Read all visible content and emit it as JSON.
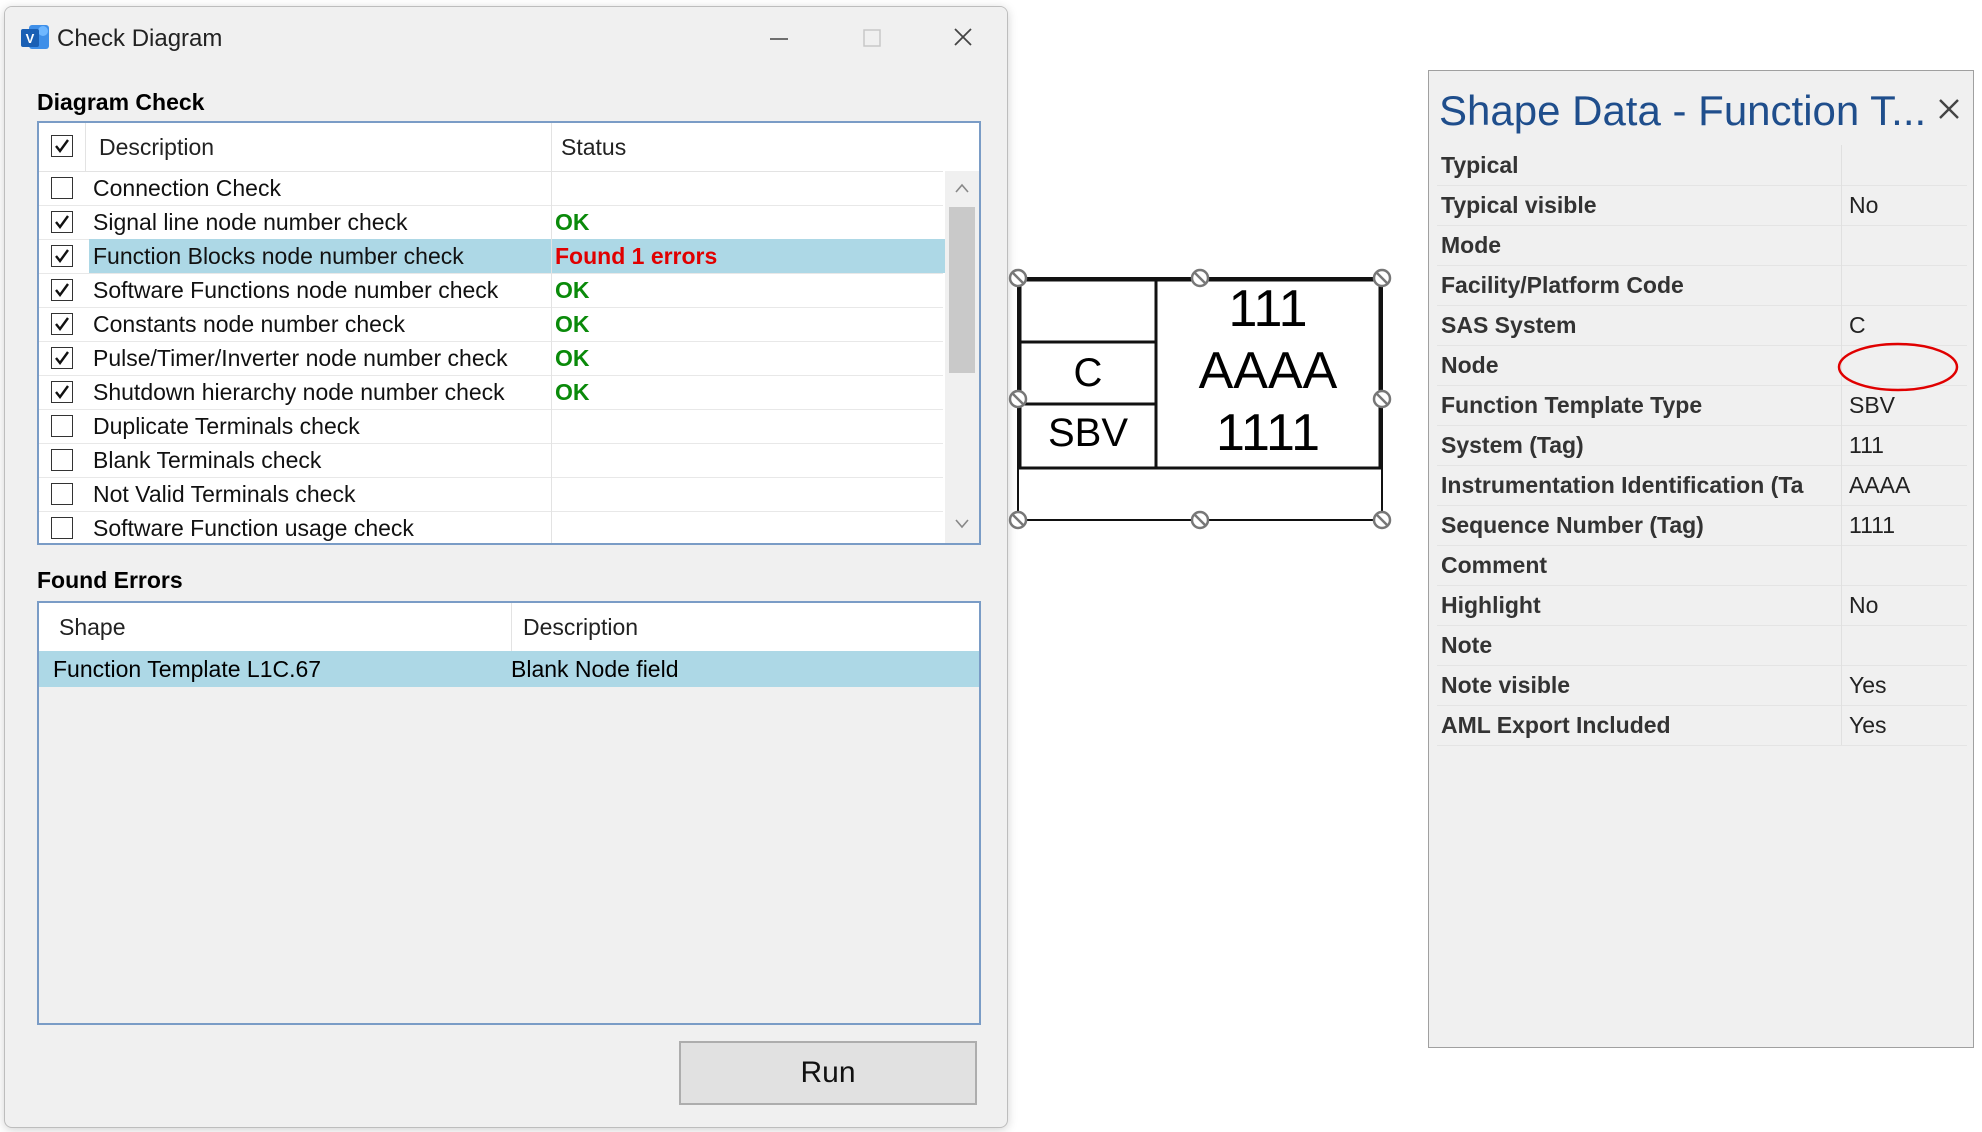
{
  "dialog": {
    "title": "Check Diagram",
    "diagram_check_label": "Diagram Check",
    "columns": {
      "description": "Description",
      "status": "Status"
    },
    "header_checked": true,
    "rows": [
      {
        "label": "Connection Check",
        "checked": false,
        "status": "",
        "status_type": ""
      },
      {
        "label": "Signal line node number check",
        "checked": true,
        "status": "OK",
        "status_type": "ok"
      },
      {
        "label": "Function Blocks node number check",
        "checked": true,
        "status": "Found 1 errors",
        "status_type": "error",
        "selected": true
      },
      {
        "label": "Software Functions node number check",
        "checked": true,
        "status": "OK",
        "status_type": "ok"
      },
      {
        "label": "Constants node number check",
        "checked": true,
        "status": "OK",
        "status_type": "ok"
      },
      {
        "label": "Pulse/Timer/Inverter node number check",
        "checked": true,
        "status": "OK",
        "status_type": "ok"
      },
      {
        "label": "Shutdown hierarchy node number check",
        "checked": true,
        "status": "OK",
        "status_type": "ok"
      },
      {
        "label": "Duplicate Terminals check",
        "checked": false,
        "status": "",
        "status_type": ""
      },
      {
        "label": "Blank Terminals check",
        "checked": false,
        "status": "",
        "status_type": ""
      },
      {
        "label": "Not Valid Terminals check",
        "checked": false,
        "status": "",
        "status_type": ""
      },
      {
        "label": "Software Function usage check",
        "checked": false,
        "status": "",
        "status_type": ""
      }
    ],
    "found_errors_label": "Found Errors",
    "errors_columns": {
      "shape": "Shape",
      "description": "Description"
    },
    "errors": [
      {
        "shape": "Function Template L1C.67",
        "description": "Blank Node field"
      }
    ],
    "run_label": "Run"
  },
  "canvas_shape": {
    "left_top": "",
    "left_mid": "C",
    "left_bottom": "SBV",
    "right_line1": "111",
    "right_line2": "AAAA",
    "right_line3": "1111"
  },
  "shape_data": {
    "title": "Shape Data - Function T...",
    "rows": [
      {
        "label": "Typical",
        "value": ""
      },
      {
        "label": "Typical visible",
        "value": "No"
      },
      {
        "label": "Mode",
        "value": ""
      },
      {
        "label": "Facility/Platform Code",
        "value": ""
      },
      {
        "label": "SAS System",
        "value": "C"
      },
      {
        "label": "Node",
        "value": ""
      },
      {
        "label": "Function Template Type",
        "value": "SBV"
      },
      {
        "label": "System (Tag)",
        "value": "111"
      },
      {
        "label": "Instrumentation Identification (Ta",
        "value": "AAAA"
      },
      {
        "label": "Sequence Number (Tag)",
        "value": "1111"
      },
      {
        "label": "Comment",
        "value": ""
      },
      {
        "label": "Highlight",
        "value": "No"
      },
      {
        "label": "Note",
        "value": ""
      },
      {
        "label": "Note visible",
        "value": "Yes"
      },
      {
        "label": "AML Export Included",
        "value": "Yes"
      }
    ]
  },
  "colors": {
    "ok": "#0a8a0a",
    "error": "#e00000",
    "selection": "#add8e6",
    "panel_title": "#1f4e8c",
    "highlight_circle": "#e00000"
  }
}
